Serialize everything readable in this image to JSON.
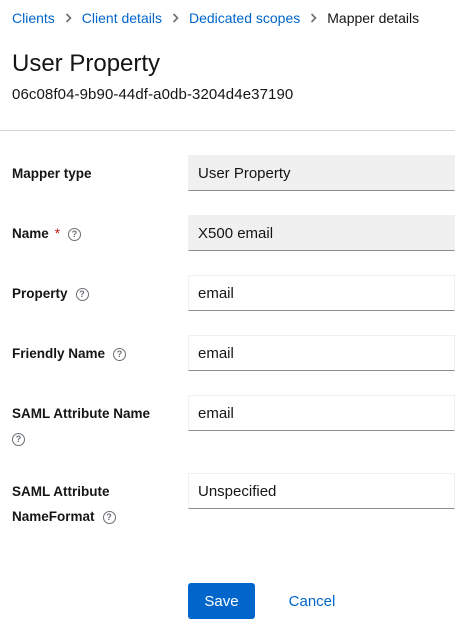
{
  "breadcrumb": {
    "items": [
      "Clients",
      "Client details",
      "Dedicated scopes"
    ],
    "current": "Mapper details"
  },
  "header": {
    "title": "User Property",
    "subtitle": "06c08f04-9b90-44df-a0db-3204d4e37190"
  },
  "form": {
    "mapper_type": {
      "label": "Mapper type",
      "value": "User Property"
    },
    "name": {
      "label": "Name",
      "required_mark": "*",
      "value": "X500 email"
    },
    "property": {
      "label": "Property",
      "value": "email"
    },
    "friendly_name": {
      "label": "Friendly Name",
      "value": "email"
    },
    "saml_attribute_name": {
      "label": "SAML Attribute Name",
      "value": "email"
    },
    "saml_attribute_nameformat": {
      "label_line1": "SAML Attribute",
      "label_line2": "NameFormat",
      "value": "Unspecified"
    },
    "help_glyph": "?"
  },
  "actions": {
    "save_label": "Save",
    "cancel_label": "Cancel"
  },
  "colors": {
    "link": "#0066cc",
    "primary": "#0066cc",
    "required": "#c9190b",
    "readonly_bg": "#f0f0f0"
  },
  "icons": {
    "separator": "chevron-right-icon",
    "help": "help-icon"
  }
}
